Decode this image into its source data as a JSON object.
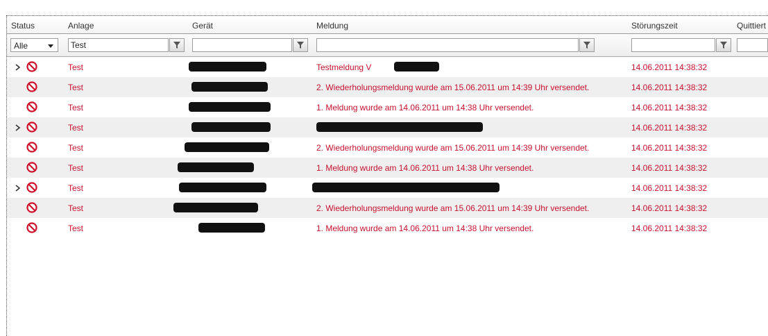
{
  "columns": {
    "status": "Status",
    "anlage": "Anlage",
    "geraet": "Gerät",
    "meldung": "Meldung",
    "stoerungszeit": "Störungszeit",
    "quittiert": "Quittiert"
  },
  "filters": {
    "status_selected": "Alle",
    "anlage_value": "Test",
    "geraet_value": "",
    "meldung_value": "",
    "stoerungszeit_value": "",
    "quittiert_value": ""
  },
  "icons": {
    "status": "no-entry-icon",
    "expand": "chevron-right-icon",
    "filter": "funnel-icon"
  },
  "colors": {
    "row_text": "#c8102e",
    "alt_row": "#efefef"
  },
  "rows": [
    {
      "expandable": true,
      "anlage": "Test",
      "meldung": "Testmeldung V",
      "zeit": "14.06.2011 14:38:32"
    },
    {
      "expandable": false,
      "anlage": "Test",
      "meldung": "2. Wiederholungsmeldung wurde am 15.06.2011 um 14:39 Uhr versendet.",
      "zeit": "14.06.2011 14:38:32"
    },
    {
      "expandable": false,
      "anlage": "Test",
      "meldung": "1. Meldung wurde am 14.06.2011 um 14:38 Uhr versendet.",
      "zeit": "14.06.2011 14:38:32"
    },
    {
      "expandable": true,
      "anlage": "Test",
      "meldung": "",
      "zeit": "14.06.2011 14:38:32"
    },
    {
      "expandable": false,
      "anlage": "Test",
      "meldung": "2. Wiederholungsmeldung wurde am 15.06.2011 um 14:39 Uhr versendet.",
      "zeit": "14.06.2011 14:38:32"
    },
    {
      "expandable": false,
      "anlage": "Test",
      "meldung": "1. Meldung wurde am 14.06.2011 um 14:38 Uhr versendet.",
      "zeit": "14.06.2011 14:38:32"
    },
    {
      "expandable": true,
      "anlage": "Test",
      "meldung": "",
      "zeit": "14.06.2011 14:38:32"
    },
    {
      "expandable": false,
      "anlage": "Test",
      "meldung": "2. Wiederholungsmeldung wurde am 15.06.2011 um 14:39 Uhr versendet.",
      "zeit": "14.06.2011 14:38:32"
    },
    {
      "expandable": false,
      "anlage": "Test",
      "meldung": "1. Meldung wurde am 14.06.2011 um 14:38 Uhr versendet.",
      "zeit": "14.06.2011 14:38:32"
    }
  ]
}
